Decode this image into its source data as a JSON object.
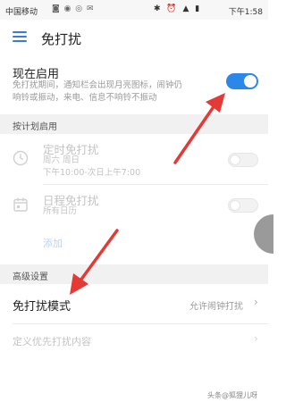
{
  "status_bar": {
    "carrier": "中国移动",
    "icons": "◙ ◉ ◎ ✉",
    "system_icons": "✱ ⏰ ▲ ▮",
    "time": "下午1:58"
  },
  "app_bar": {
    "title": "免打扰"
  },
  "now_enable": {
    "title": "现在启用",
    "description_line1": "免打扰期间，通知栏会出现月亮图标，闹钟仍",
    "description_line2": "响铃或振动，来电、信息不响铃不振动",
    "toggle_state": "on"
  },
  "scheduled_section": {
    "header": "按计划启用",
    "timed": {
      "title": "定时免打扰",
      "days": "周六 周日",
      "time_range": "下午10:00-次日上午7:00",
      "toggle_state": "off"
    },
    "calendar": {
      "title": "日程免打扰",
      "subtitle": "所有日历",
      "toggle_state": "off"
    },
    "add_label": "添加"
  },
  "advanced_section": {
    "header": "高级设置",
    "dnd_mode": {
      "title": "免打扰模式",
      "value": "允许闹钟打扰"
    },
    "priority_content": {
      "title": "定义优先打扰内容"
    }
  },
  "watermark": "头条@狐狸儿呀",
  "colors": {
    "accent": "#2b87e8",
    "arrow": "#e53935",
    "section_bg": "#f1f1f1",
    "disabled_text": "#c4c4c4"
  }
}
